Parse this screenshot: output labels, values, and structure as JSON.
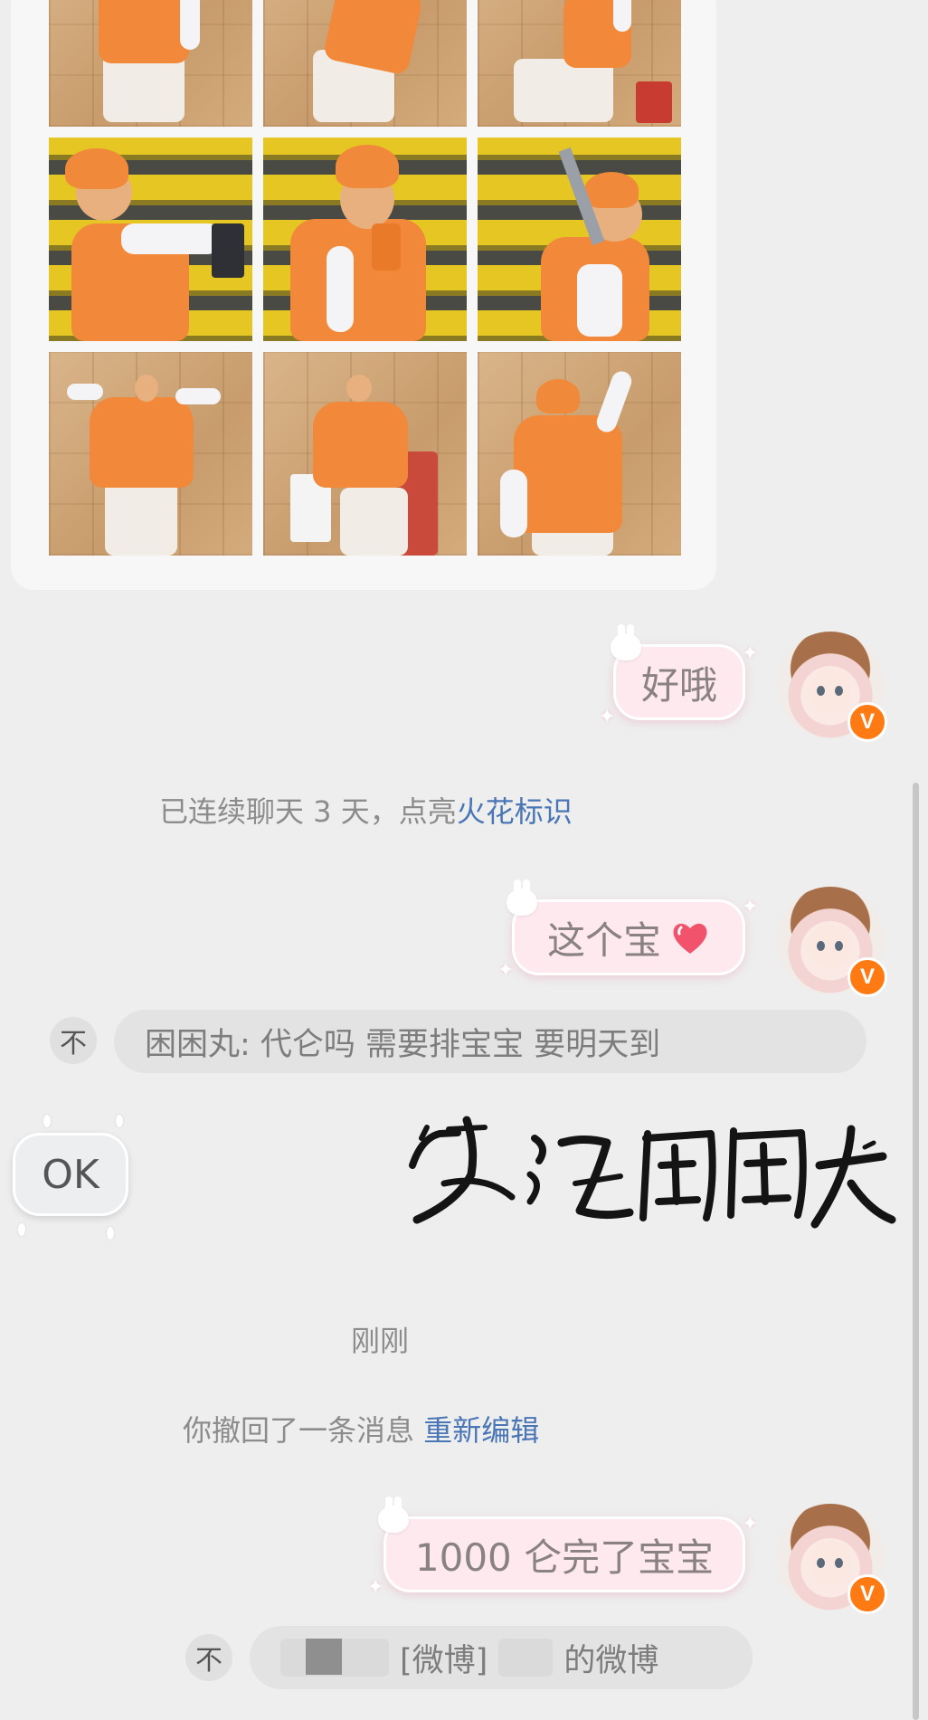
{
  "photo_grid": {
    "rows": [
      [
        {
          "scene": "wall"
        },
        {
          "scene": "wall"
        },
        {
          "scene": "wall"
        }
      ],
      [
        {
          "scene": "shelf"
        },
        {
          "scene": "shelf"
        },
        {
          "scene": "shelf"
        }
      ],
      [
        {
          "scene": "wall"
        },
        {
          "scene": "wall"
        },
        {
          "scene": "wall"
        }
      ]
    ]
  },
  "messages": {
    "m1": {
      "text": "好哦"
    },
    "system_streak": {
      "prefix": "已连续聊天 3 天，点亮",
      "link": "火花标识"
    },
    "m2": {
      "text": "这个宝",
      "emoji": "heart-emoji"
    },
    "quote1": {
      "text": "困困丸: 代仑吗  需要排宝宝  要明天到"
    },
    "sticker_ok": {
      "text": "OK"
    },
    "calligraphy_sticker": {
      "alt": "哭泣困困丸"
    },
    "time_label": "刚刚",
    "recall": {
      "text": "你撤回了一条消息",
      "link": "重新编辑"
    },
    "m3": {
      "text": "1000 仑完了宝宝"
    },
    "quote2": {
      "tag": "[微博]",
      "suffix": "的微博"
    }
  },
  "colors": {
    "bubble": "#fde9ee",
    "link": "#4a76b5",
    "badge": "#ff7a13",
    "background": "#eeeeee"
  },
  "icons": {
    "verified": "V",
    "quote_up": "不"
  }
}
